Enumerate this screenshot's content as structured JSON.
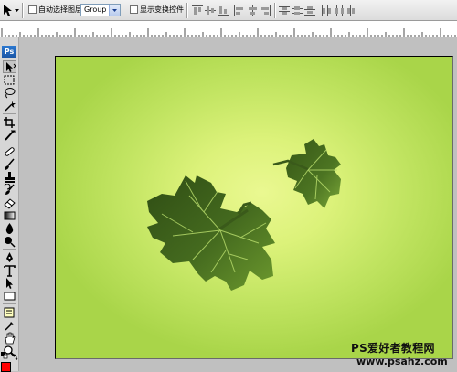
{
  "options_bar": {
    "auto_select_label": "自动选择图层",
    "auto_select_value": "Group",
    "show_transform_label": "显示变换控件"
  },
  "toolbox": {
    "logo": "Ps",
    "foreground_color": "#ff0000",
    "tools": [
      "move-tool",
      "marquee-tool",
      "lasso-tool",
      "magic-wand-tool",
      "crop-tool",
      "slice-tool",
      "healing-brush-tool",
      "brush-tool",
      "clone-stamp-tool",
      "history-brush-tool",
      "eraser-tool",
      "gradient-tool",
      "blur-tool",
      "dodge-tool",
      "pen-tool",
      "type-tool",
      "path-selection-tool",
      "shape-tool",
      "notes-tool",
      "eyedropper-tool",
      "hand-tool",
      "zoom-tool"
    ]
  },
  "canvas": {
    "background_center": "#eaf891",
    "background_edge": "#a9d549",
    "leaf_color": "#3a5a1a"
  },
  "watermark": {
    "line1": "PS爱好者教程网",
    "line2": "www.psahz.com"
  }
}
